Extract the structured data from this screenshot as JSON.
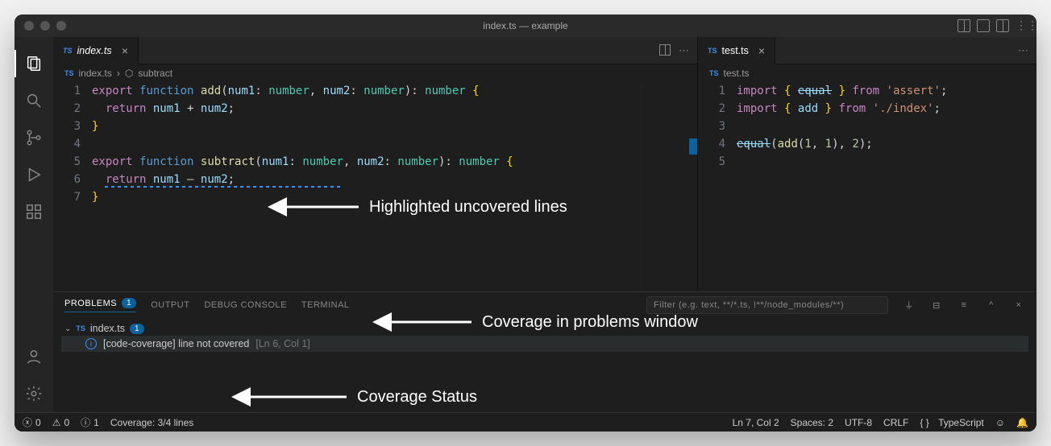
{
  "window": {
    "title": "index.ts — example"
  },
  "activity": {
    "items": [
      "files-icon",
      "search-icon",
      "source-control-icon",
      "run-icon",
      "extensions-icon"
    ],
    "bottom": [
      "account-icon",
      "settings-gear-icon"
    ]
  },
  "editorLeft": {
    "tab": {
      "icon": "TS",
      "label": "index.ts"
    },
    "breadcrumb": {
      "icon": "TS",
      "file": "index.ts",
      "symbol": "subtract"
    },
    "lines": [
      {
        "n": 1,
        "tokens": [
          [
            "kw",
            "export"
          ],
          [
            "sp",
            " "
          ],
          [
            "kw2",
            "function"
          ],
          [
            "sp",
            " "
          ],
          [
            "fn",
            "add"
          ],
          [
            "op",
            "("
          ],
          [
            "var",
            "num1"
          ],
          [
            "op",
            ":"
          ],
          [
            "sp",
            " "
          ],
          [
            "type",
            "number"
          ],
          [
            "op",
            ","
          ],
          [
            "sp",
            " "
          ],
          [
            "var",
            "num2"
          ],
          [
            "op",
            ":"
          ],
          [
            "sp",
            " "
          ],
          [
            "type",
            "number"
          ],
          [
            "op",
            "):"
          ],
          [
            "sp",
            " "
          ],
          [
            "type",
            "number"
          ],
          [
            "sp",
            " "
          ],
          [
            "brace",
            "{"
          ]
        ]
      },
      {
        "n": 2,
        "tokens": [
          [
            "sp",
            "  "
          ],
          [
            "kw",
            "return"
          ],
          [
            "sp",
            " "
          ],
          [
            "var",
            "num1"
          ],
          [
            "sp",
            " "
          ],
          [
            "op",
            "+"
          ],
          [
            "sp",
            " "
          ],
          [
            "var",
            "num2"
          ],
          [
            "op",
            ";"
          ]
        ]
      },
      {
        "n": 3,
        "tokens": [
          [
            "brace",
            "}"
          ]
        ]
      },
      {
        "n": 4,
        "tokens": []
      },
      {
        "n": 5,
        "tokens": [
          [
            "kw",
            "export"
          ],
          [
            "sp",
            " "
          ],
          [
            "kw2",
            "function"
          ],
          [
            "sp",
            " "
          ],
          [
            "fn",
            "subtract"
          ],
          [
            "op",
            "("
          ],
          [
            "var",
            "num1"
          ],
          [
            "op",
            ":"
          ],
          [
            "sp",
            " "
          ],
          [
            "type",
            "number"
          ],
          [
            "op",
            ","
          ],
          [
            "sp",
            " "
          ],
          [
            "var",
            "num2"
          ],
          [
            "op",
            ":"
          ],
          [
            "sp",
            " "
          ],
          [
            "type",
            "number"
          ],
          [
            "op",
            "):"
          ],
          [
            "sp",
            " "
          ],
          [
            "type",
            "number"
          ],
          [
            "sp",
            " "
          ],
          [
            "brace",
            "{"
          ]
        ]
      },
      {
        "n": 6,
        "tokens": [
          [
            "sp",
            "  "
          ],
          [
            "kw",
            "return"
          ],
          [
            "sp",
            " "
          ],
          [
            "var",
            "num1"
          ],
          [
            "sp",
            " "
          ],
          [
            "op",
            "–"
          ],
          [
            "sp",
            " "
          ],
          [
            "var",
            "num2"
          ],
          [
            "op",
            ";"
          ]
        ],
        "uncovered": true
      },
      {
        "n": 7,
        "tokens": [
          [
            "brace",
            "}"
          ]
        ]
      }
    ]
  },
  "editorRight": {
    "tab": {
      "icon": "TS",
      "label": "test.ts"
    },
    "breadcrumb": {
      "icon": "TS",
      "file": "test.ts"
    },
    "lines": [
      {
        "n": 1,
        "tokens": [
          [
            "kw",
            "import"
          ],
          [
            "sp",
            " "
          ],
          [
            "brace",
            "{"
          ],
          [
            "sp",
            " "
          ],
          [
            "dep",
            "equal"
          ],
          [
            "sp",
            " "
          ],
          [
            "brace",
            "}"
          ],
          [
            "sp",
            " "
          ],
          [
            "kw",
            "from"
          ],
          [
            "sp",
            " "
          ],
          [
            "str",
            "'assert'"
          ],
          [
            "op",
            ";"
          ]
        ]
      },
      {
        "n": 2,
        "tokens": [
          [
            "kw",
            "import"
          ],
          [
            "sp",
            " "
          ],
          [
            "brace",
            "{"
          ],
          [
            "sp",
            " "
          ],
          [
            "var",
            "add"
          ],
          [
            "sp",
            " "
          ],
          [
            "brace",
            "}"
          ],
          [
            "sp",
            " "
          ],
          [
            "kw",
            "from"
          ],
          [
            "sp",
            " "
          ],
          [
            "str",
            "'./index'"
          ],
          [
            "op",
            ";"
          ]
        ]
      },
      {
        "n": 3,
        "tokens": []
      },
      {
        "n": 4,
        "tokens": [
          [
            "dep",
            "equal"
          ],
          [
            "op",
            "("
          ],
          [
            "fn",
            "add"
          ],
          [
            "op",
            "("
          ],
          [
            "num",
            "1"
          ],
          [
            "op",
            ","
          ],
          [
            "sp",
            " "
          ],
          [
            "num",
            "1"
          ],
          [
            "op",
            "),"
          ],
          [
            "sp",
            " "
          ],
          [
            "num",
            "2"
          ],
          [
            "op",
            ");"
          ]
        ]
      },
      {
        "n": 5,
        "tokens": []
      }
    ]
  },
  "panel": {
    "tabs": [
      "PROBLEMS",
      "OUTPUT",
      "DEBUG CONSOLE",
      "TERMINAL"
    ],
    "active": 0,
    "badge": "1",
    "filter_placeholder": "Filter (e.g. text, **/*.ts, !**/node_modules/**)",
    "problems": {
      "file": {
        "icon": "TS",
        "name": "index.ts",
        "count": "1"
      },
      "items": [
        {
          "msg": "[code-coverage] line not covered",
          "loc": "[Ln 6, Col 1]"
        }
      ]
    }
  },
  "status": {
    "errors": "0",
    "warnings": "0",
    "info": "1",
    "coverage": "Coverage: 3/4 lines",
    "pos": "Ln 7, Col 2",
    "spaces": "Spaces: 2",
    "encoding": "UTF-8",
    "eol": "CRLF",
    "lang_icon": "{ }",
    "lang": "TypeScript"
  },
  "annotations": {
    "a1": "Highlighted uncovered lines",
    "a2": "Coverage in problems window",
    "a3": "Coverage Status"
  }
}
